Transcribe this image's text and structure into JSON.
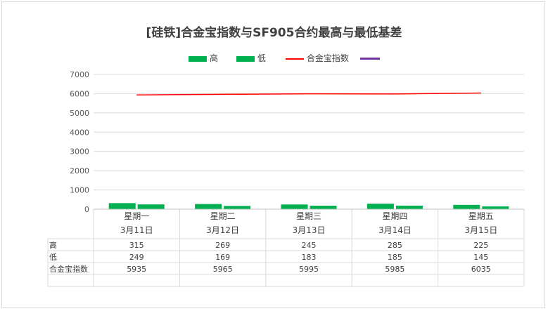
{
  "chart_data": {
    "type": "bar",
    "title": "[硅铁]合金宝指数与SF905合约最高与最低基差",
    "categories": [
      "星期一",
      "星期二",
      "星期三",
      "星期四",
      "星期五"
    ],
    "dates": [
      "3月11日",
      "3月12日",
      "3月13日",
      "3月14日",
      "3月15日"
    ],
    "series": [
      {
        "name": "高",
        "kind": "bar",
        "color": "#00b050",
        "values": [
          315,
          269,
          245,
          285,
          225
        ]
      },
      {
        "name": "低",
        "kind": "bar",
        "color": "#00b050",
        "values": [
          249,
          169,
          183,
          185,
          145
        ]
      },
      {
        "name": "合金宝指数",
        "kind": "line",
        "color": "#ff0000",
        "values": [
          5935,
          5965,
          5995,
          5985,
          6035
        ]
      },
      {
        "name": "",
        "kind": "line",
        "color": "#7030a0",
        "values": []
      }
    ],
    "ylim": [
      0,
      7000
    ],
    "yticks": [
      0,
      1000,
      2000,
      3000,
      4000,
      5000,
      6000,
      7000
    ],
    "grid": true,
    "legend_position": "top",
    "data_table": {
      "rows": [
        {
          "label": "高",
          "values": [
            "315",
            "269",
            "245",
            "285",
            "225"
          ]
        },
        {
          "label": "低",
          "values": [
            "249",
            "169",
            "183",
            "185",
            "145"
          ]
        },
        {
          "label": "合金宝指数",
          "values": [
            "5935",
            "5965",
            "5995",
            "5985",
            "6035"
          ]
        }
      ]
    }
  }
}
